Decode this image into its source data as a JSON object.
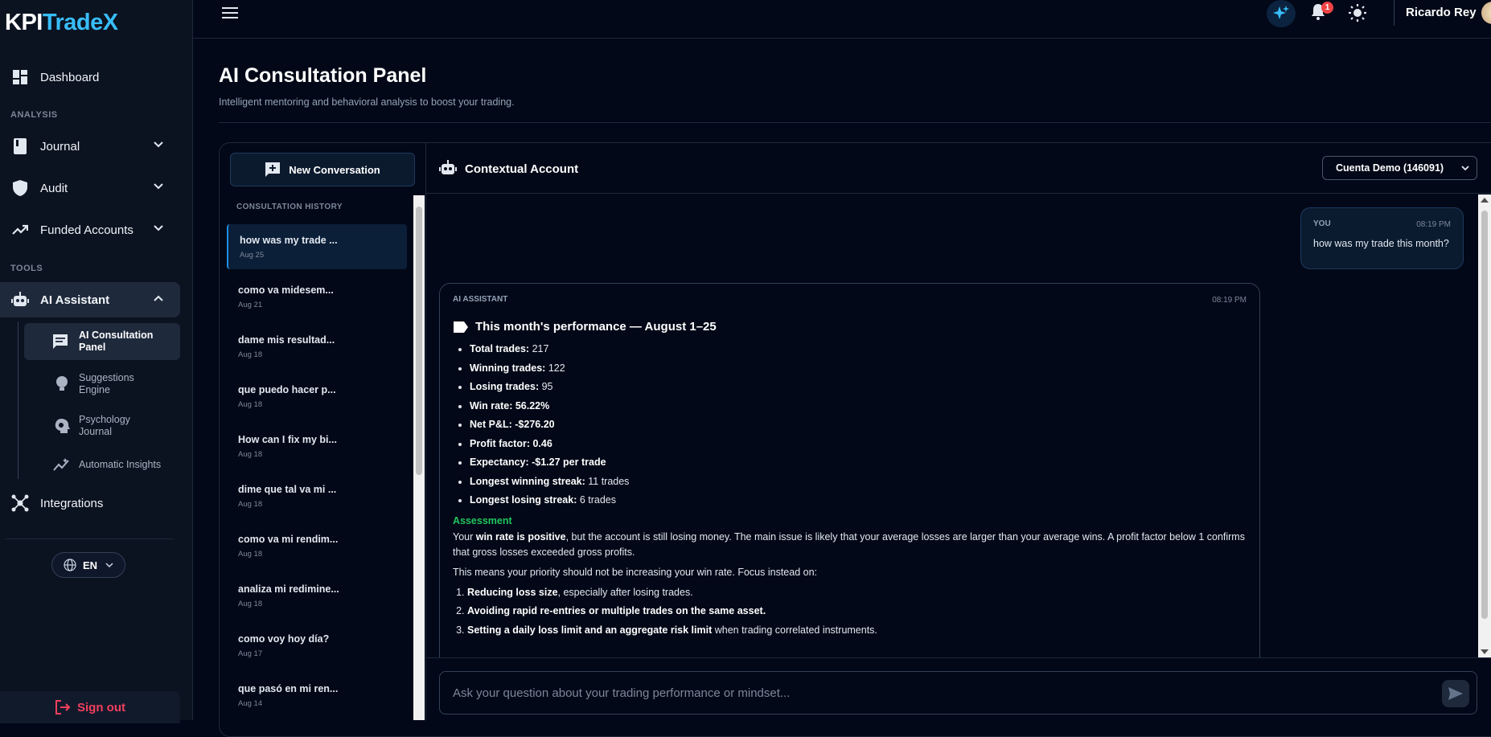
{
  "brand": {
    "part1": "KPI",
    "part2": "TradeX"
  },
  "sidebar": {
    "dashboard": "Dashboard",
    "analysis_label": "ANALYSIS",
    "journal": "Journal",
    "audit": "Audit",
    "funded_accounts": "Funded Accounts",
    "tools_label": "TOOLS",
    "ai_assistant": "AI Assistant",
    "sub_items": [
      {
        "label": "AI Consultation Panel"
      },
      {
        "label": "Suggestions Engine"
      },
      {
        "label": "Psychology Journal"
      },
      {
        "label": "Automatic Insights"
      }
    ],
    "integrations": "Integrations",
    "language": "EN",
    "sign_out": "Sign out"
  },
  "topbar": {
    "notification_count": "1",
    "username": "Ricardo Rey"
  },
  "page": {
    "title": "AI Consultation Panel",
    "subtitle": "Intelligent mentoring and behavioral analysis to boost your trading."
  },
  "history": {
    "new_conversation": "New Conversation",
    "label": "CONSULTATION HISTORY",
    "items": [
      {
        "title": "how was my trade ...",
        "date": "Aug 25"
      },
      {
        "title": "como va midesem...",
        "date": "Aug 21"
      },
      {
        "title": "dame mis resultad...",
        "date": "Aug 18"
      },
      {
        "title": "que puedo hacer p...",
        "date": "Aug 18"
      },
      {
        "title": "How can I fix my bi...",
        "date": "Aug 18"
      },
      {
        "title": "dime que tal va mi ...",
        "date": "Aug 18"
      },
      {
        "title": "como va mi rendim...",
        "date": "Aug 18"
      },
      {
        "title": "analiza mi redimine...",
        "date": "Aug 18"
      },
      {
        "title": "como voy hoy día?",
        "date": "Aug 17"
      },
      {
        "title": "que pasó en mi ren...",
        "date": "Aug 14"
      }
    ]
  },
  "chat": {
    "header": "Contextual Account",
    "account": "Cuenta Demo (146091)",
    "user_msg": {
      "who": "YOU",
      "time": "08:19 PM",
      "text": "how was my trade this month?"
    },
    "ai_msg": {
      "who": "AI ASSISTANT",
      "time": "08:19 PM",
      "heading": "This month's performance — August 1–25",
      "stats": [
        {
          "label": "Total trades:",
          "value": " 217"
        },
        {
          "label": "Winning trades:",
          "value": " 122"
        },
        {
          "label": "Losing trades:",
          "value": " 95"
        },
        {
          "label": "Win rate: 56.22%",
          "value": ""
        },
        {
          "label": "Net P&L: -$276.20",
          "value": ""
        },
        {
          "label": "Profit factor: 0.46",
          "value": ""
        },
        {
          "label": "Expectancy: -$1.27 per trade",
          "value": ""
        },
        {
          "label": "Longest winning streak:",
          "value": " 11 trades"
        },
        {
          "label": "Longest losing streak:",
          "value": " 6 trades"
        }
      ],
      "assessment_title": "Assessment",
      "p1_a": "Your ",
      "p1_b": "win rate is positive",
      "p1_c": ", but the account is still losing money. The main issue is likely that your average losses are larger than your average wins. A profit factor below 1 confirms that gross losses exceeded gross profits.",
      "p2": "This means your priority should not be increasing your win rate. Focus instead on:",
      "focus": [
        {
          "bold": "Reducing loss size",
          "rest": ", especially after losing trades."
        },
        {
          "bold": "Avoiding rapid re-entries or multiple trades on the same asset.",
          "rest": ""
        },
        {
          "bold": "Setting a daily loss limit and an aggregate risk limit",
          "rest": " when trading correlated instruments."
        }
      ]
    },
    "input_placeholder": "Ask your question about your trading performance or mindset..."
  }
}
